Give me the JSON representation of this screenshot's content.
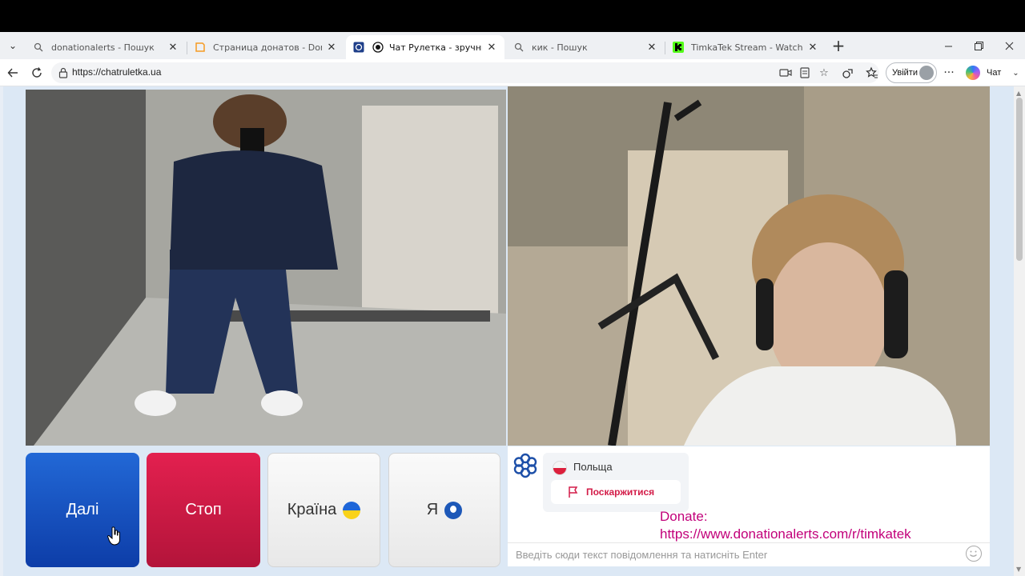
{
  "tabs": [
    {
      "label": "donationalerts - Пошук",
      "icon": "search-icon",
      "close": "✕"
    },
    {
      "label": "Страница донатов - DonationAlerts",
      "icon": "donationalerts-icon",
      "close": "✕"
    },
    {
      "label": "Чат Рулетка - зручний та безпечний",
      "icon": "chatruletka-icon",
      "close": "✕",
      "active": true
    },
    {
      "label": "кик - Пошук",
      "icon": "search-icon",
      "close": "✕"
    },
    {
      "label": "TimkaTek Stream - Watch Live on Kick",
      "icon": "kick-icon",
      "close": "✕"
    }
  ],
  "browser": {
    "url": "https://chatruletka.ua",
    "signin_label": "Увійти",
    "copilot_label": "Чат"
  },
  "controls": {
    "next_label": "Далі",
    "stop_label": "Стоп",
    "country_label": "Країна",
    "me_label": "Я"
  },
  "chat": {
    "country": "Польща",
    "report_label": "Поскаржитися",
    "donate_line1": "Donate:",
    "donate_line2": "https://www.donationalerts.com/r/timkatek",
    "input_placeholder": "Введіть сюди текст повідомлення та натисніть Enter"
  },
  "colors": {
    "next_button": "#1a55c8",
    "stop_button": "#d81a47",
    "donate_text": "#c2007a",
    "report_text": "#d31c48"
  }
}
